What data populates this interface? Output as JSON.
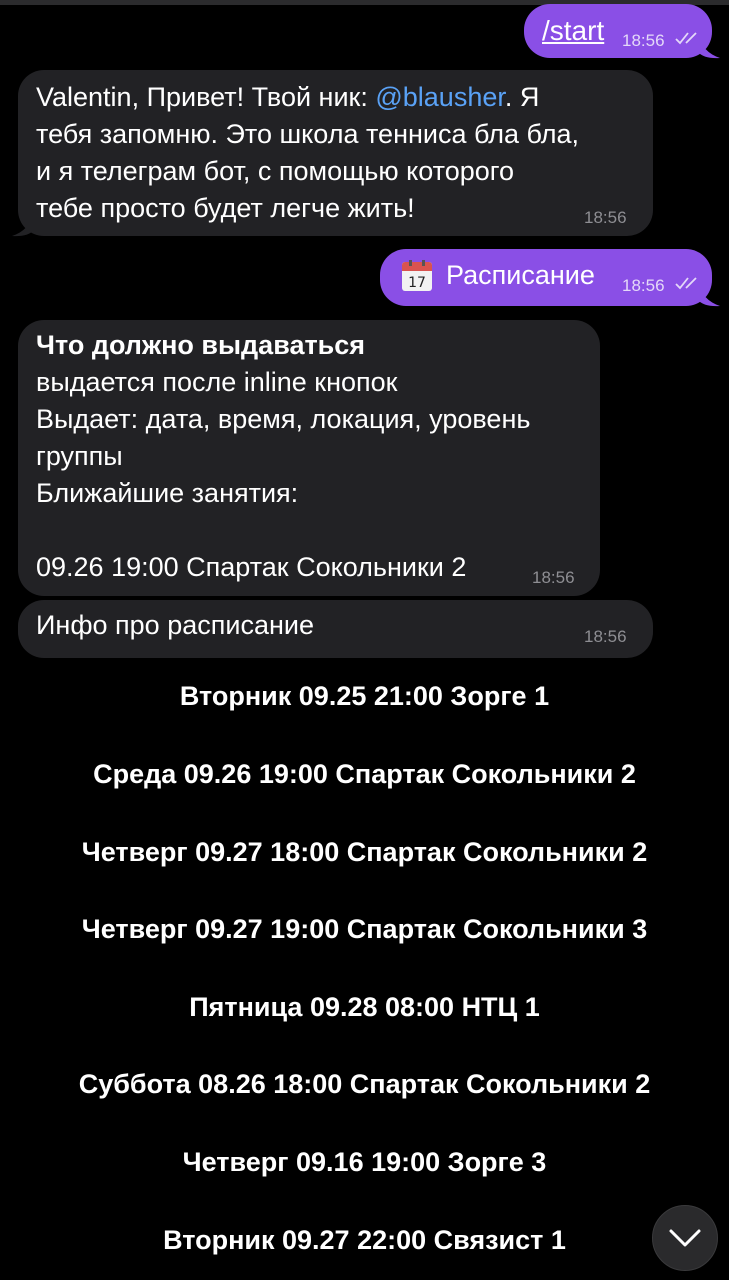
{
  "messages": {
    "start": {
      "text": "/start",
      "time": "18:56"
    },
    "greeting": {
      "prefix": "Valentin, Привет! Твой ник: ",
      "mention": "@blausher",
      "suffix": ". Я",
      "line2": "тебя запомню. Это школа тенниса бла бла,",
      "line3": "и я телеграм бот, с помощью которого",
      "line4": "тебе просто будет легче жить!",
      "time": "18:56"
    },
    "schedule_cmd": {
      "text": "Расписание",
      "time": "18:56",
      "icon": "calendar-icon"
    },
    "description": {
      "title": "Что должно выдаваться",
      "line1": "выдается после inline кнопок",
      "line2": "Выдает: дата, время, локация, уровень",
      "line3": "группы",
      "line4": "Ближайшие занятия:",
      "line5": "09.26 19:00 Спартак Сокольники 2",
      "time": "18:56"
    },
    "info": {
      "text": "Инфо про расписание",
      "time": "18:56"
    }
  },
  "schedule": [
    "Вторник 09.25 21:00 Зорге 1",
    "Среда 09.26 19:00 Спартак Сокольники 2",
    "Четверг 09.27 18:00 Спартак Сокольники 2",
    "Четверг 09.27 19:00 Спартак Сокольники 3",
    "Пятница 09.28 08:00 НТЦ 1",
    "Суббота 08.26 18:00 Спартак Сокольники 2",
    "Четверг 09.16 19:00 Зорге 3",
    "Вторник 09.27 22:00 Связист 1"
  ],
  "colors": {
    "outgoing": "#8a4fe6",
    "incoming": "#222225",
    "link": "#5aa2f6",
    "background": "#000000"
  }
}
